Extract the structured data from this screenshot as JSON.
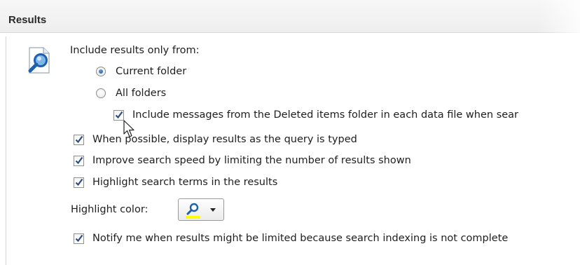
{
  "section": {
    "title": "Results"
  },
  "include_from": {
    "label": "Include results only from:",
    "options": [
      {
        "label": "Current folder",
        "selected": true
      },
      {
        "label": "All folders",
        "selected": false
      }
    ],
    "deleted_items": {
      "label": "Include messages from the Deleted items folder in each data file when sear",
      "checked": true
    }
  },
  "options": [
    {
      "label": "When possible, display results as the query is typed",
      "checked": true
    },
    {
      "label": "Improve search speed by limiting the number of results shown",
      "checked": true
    },
    {
      "label": "Highlight search terms in the results",
      "checked": true
    }
  ],
  "highlight_color": {
    "label": "Highlight color:",
    "swatch": "#ffff00"
  },
  "notify": {
    "label": "Notify me when results might be limited because search indexing is not complete",
    "checked": true
  },
  "colors": {
    "check_mark": "#2b4d7e",
    "icon_blue": "#1f5fb0",
    "highlight_yellow": "#ffff00"
  }
}
